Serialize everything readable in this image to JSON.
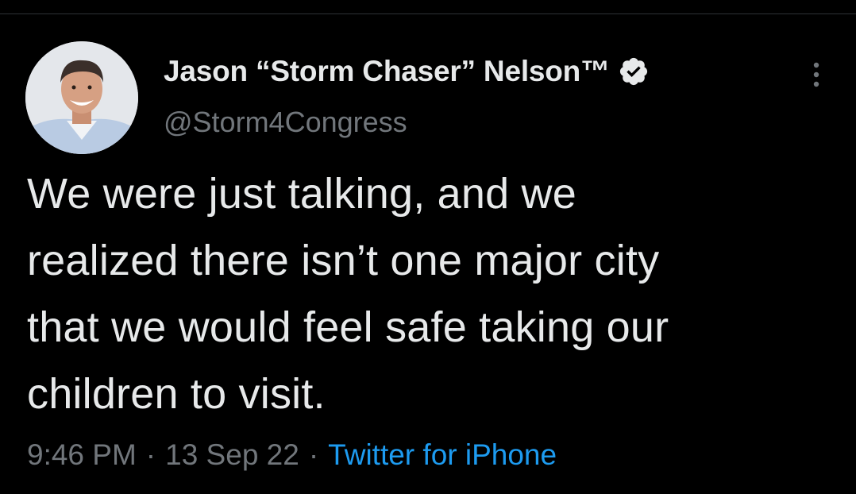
{
  "tweet": {
    "author": {
      "display_name": "Jason “Storm Chaser” Nelson™",
      "handle": "@Storm4Congress",
      "verified": true,
      "avatar_icon": "profile-photo-smiling-man"
    },
    "text": "We were just talking, and we\nrealized there isn’t one major city\nthat we would feel safe taking our\nchildren to visit.",
    "time": "9:46 PM",
    "separator": "·",
    "date": "13 Sep 22",
    "source": "Twitter for iPhone"
  },
  "icons": {
    "verified": "verified-badge-icon",
    "more": "more-vertical-icon"
  },
  "colors": {
    "background": "#000000",
    "primary_text": "#e7e9ea",
    "secondary_text": "#71767b",
    "accent": "#1d9bf0",
    "divider": "#2f3336"
  }
}
